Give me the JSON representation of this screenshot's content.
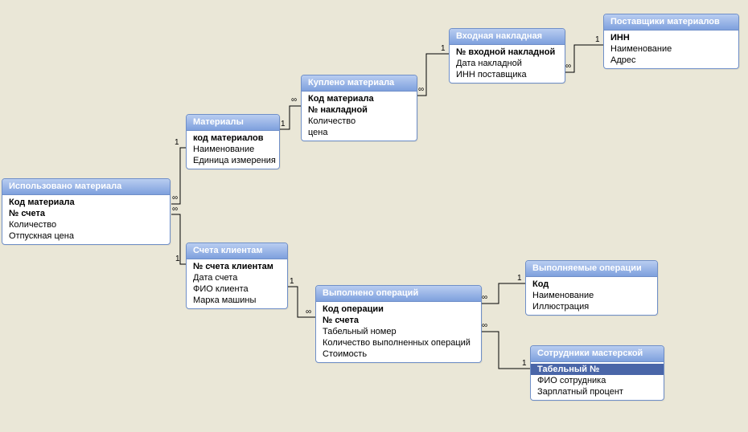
{
  "entities": {
    "used_material": {
      "title": "Использовано материала",
      "fields": [
        {
          "label": "Код материала",
          "pk": true
        },
        {
          "label": "№ счета",
          "pk": true
        },
        {
          "label": "Количество"
        },
        {
          "label": "Отпускная цена"
        }
      ]
    },
    "materials": {
      "title": "Материалы",
      "fields": [
        {
          "label": "код материалов",
          "pk": true
        },
        {
          "label": "Наименование"
        },
        {
          "label": "Единица измерения"
        }
      ]
    },
    "bought_material": {
      "title": "Куплено материала",
      "fields": [
        {
          "label": "Код материала",
          "pk": true
        },
        {
          "label": "№ накладной",
          "pk": true
        },
        {
          "label": "Количество"
        },
        {
          "label": "цена"
        }
      ]
    },
    "incoming_invoice": {
      "title": "Входная накладная",
      "fields": [
        {
          "label": "№ входной накладной",
          "pk": true
        },
        {
          "label": "Дата накладной"
        },
        {
          "label": "ИНН поставщика"
        }
      ]
    },
    "suppliers": {
      "title": "Поставщики материалов",
      "fields": [
        {
          "label": "ИНН",
          "pk": true
        },
        {
          "label": "Наименование"
        },
        {
          "label": "Адрес"
        }
      ]
    },
    "client_invoices": {
      "title": "Счета клиентам",
      "fields": [
        {
          "label": "№ счета клиентам",
          "pk": true
        },
        {
          "label": "Дата счета"
        },
        {
          "label": "ФИО клиента"
        },
        {
          "label": "Марка машины"
        }
      ]
    },
    "operations_done": {
      "title": "Выполнено операций",
      "fields": [
        {
          "label": "Код операции",
          "pk": true
        },
        {
          "label": "№ счета",
          "pk": true
        },
        {
          "label": "Табельный номер"
        },
        {
          "label": "Количество выполненных операций"
        },
        {
          "label": "Стоимость"
        }
      ]
    },
    "operations": {
      "title": "Выполняемые операции",
      "fields": [
        {
          "label": "Код",
          "pk": true
        },
        {
          "label": "Наименование"
        },
        {
          "label": "Иллюстрация"
        }
      ]
    },
    "employees": {
      "title": "Сотрудники мастерской",
      "fields": [
        {
          "label": "Табельный №",
          "pk": true,
          "selected": true
        },
        {
          "label": "ФИО сотрудника"
        },
        {
          "label": "Зарплатный процент"
        }
      ]
    }
  },
  "labels": {
    "one": "1",
    "many": "∞"
  }
}
